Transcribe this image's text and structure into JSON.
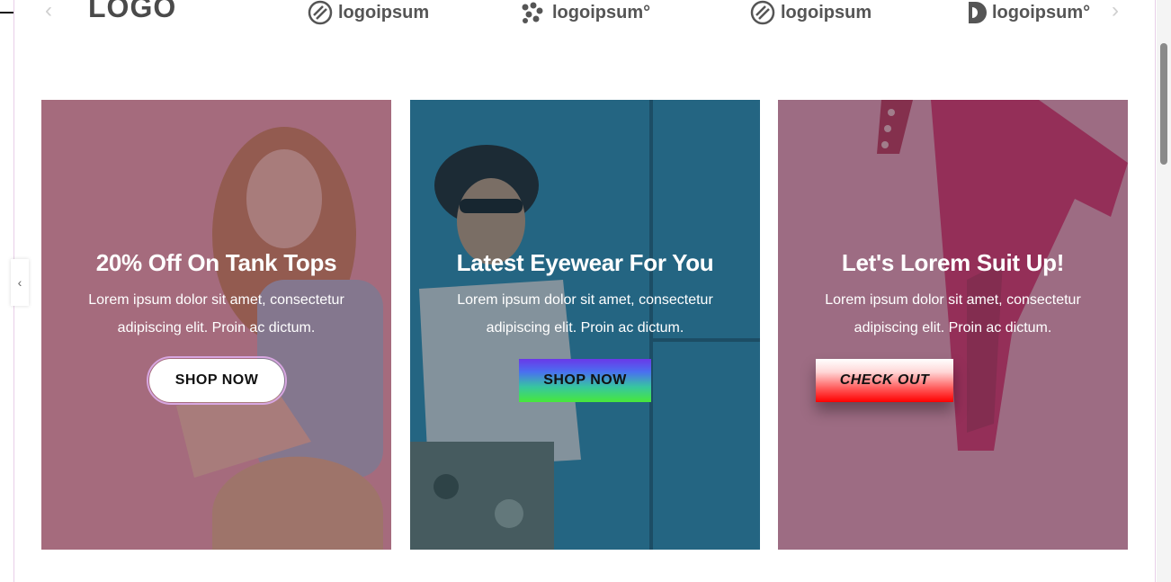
{
  "logos": {
    "prev_arrow": "‹",
    "next_arrow": "›",
    "items": [
      {
        "label": "LOGO",
        "icon": "block-logo-icon"
      },
      {
        "label": "logoipsum",
        "icon": "circle-stripes-icon"
      },
      {
        "label": "logoipsum°",
        "icon": "dots-cluster-icon"
      },
      {
        "label": "logoipsum",
        "icon": "circle-stripes-icon"
      },
      {
        "label": "logoipsum°",
        "icon": "half-circle-icon"
      }
    ]
  },
  "side_tab": {
    "icon": "chevron-left-icon",
    "glyph": "‹"
  },
  "cards": [
    {
      "title": "20% Off On Tank Tops",
      "description": "Lorem ipsum dolor sit amet, consectetur adipiscing elit. Proin ac dictum.",
      "button": "SHOP NOW"
    },
    {
      "title": "Latest Eyewear For You",
      "description": "Lorem ipsum dolor sit amet, consectetur adipiscing elit. Proin ac dictum.",
      "button": "SHOP NOW"
    },
    {
      "title": "Let's Lorem Suit Up!",
      "description": "Lorem ipsum dolor sit amet, consectetur adipiscing elit. Proin ac dictum.",
      "button": "CHECK OUT"
    }
  ],
  "colors": {
    "card1_overlay": "#8c5a6c",
    "card2_overlay": "#2f6f88",
    "card3_overlay": "#7f5c6f",
    "button_outline": "#d7a6e0"
  }
}
